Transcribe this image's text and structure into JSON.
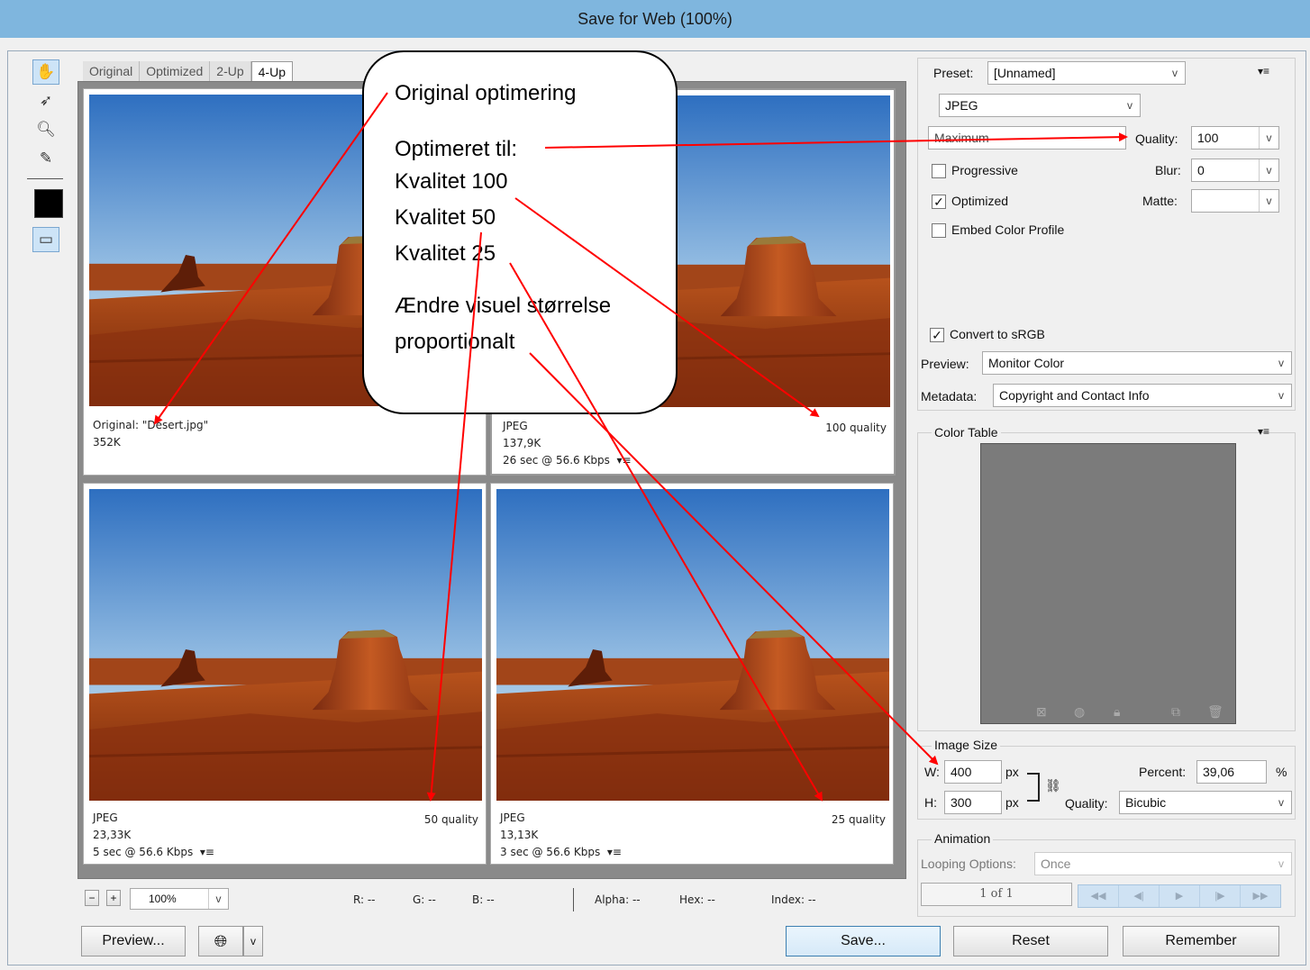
{
  "window": {
    "title": "Save for Web (100%)"
  },
  "tools": [
    {
      "icon": "hand-tool-icon"
    },
    {
      "icon": "slice-select-icon"
    },
    {
      "icon": "zoom-icon"
    },
    {
      "icon": "eyedropper-icon"
    },
    {
      "icon": "eyedropper-color-swatch-icon"
    },
    {
      "icon": "toggle-slices-icon"
    }
  ],
  "tabs": [
    "Original",
    "Optimized",
    "2-Up",
    "4-Up"
  ],
  "panes": [
    {
      "line1": "Original: \"Desert.jpg\"",
      "line2": "352K",
      "line3": "",
      "quality": ""
    },
    {
      "line1": "JPEG",
      "line2": "137,9K",
      "line3": "26 sec @ 56.6 Kbps",
      "quality": "100 quality"
    },
    {
      "line1": "JPEG",
      "line2": "23,33K",
      "line3": "5 sec @ 56.6 Kbps",
      "quality": "50 quality"
    },
    {
      "line1": "JPEG",
      "line2": "13,13K",
      "line3": "3 sec @ 56.6 Kbps",
      "quality": "25 quality"
    }
  ],
  "pane_menu_glyph": "▾≡",
  "zoom": {
    "minus": "−",
    "plus": "+",
    "value": "100%"
  },
  "status": {
    "r": "R: --",
    "g": "G: --",
    "b": "B: --",
    "alpha": "Alpha: --",
    "hex": "Hex: --",
    "index": "Index: --"
  },
  "bottom": {
    "preview": "Preview...",
    "save": "Save...",
    "reset": "Reset",
    "remember": "Remember"
  },
  "settings": {
    "preset_label": "Preset:",
    "preset_value": "[Unnamed]",
    "format": "JPEG",
    "quality_preset": "Maximum",
    "quality_label": "Quality:",
    "quality_value": "100",
    "blur_label": "Blur:",
    "blur_value": "0",
    "matte_label": "Matte:",
    "matte_value": "",
    "progressive": "Progressive",
    "progressive_checked": false,
    "optimized": "Optimized",
    "optimized_checked": true,
    "embed": "Embed Color Profile",
    "embed_checked": false,
    "convert": "Convert to sRGB",
    "convert_checked": true,
    "preview_label": "Preview:",
    "preview_value": "Monitor Color",
    "metadata_label": "Metadata:",
    "metadata_value": "Copyright and Contact Info"
  },
  "color_table": {
    "title": "Color Table",
    "swatch_color": "#7b7b7b"
  },
  "image_size": {
    "title": "Image Size",
    "w_label": "W:",
    "w_value": "400",
    "w_unit": "px",
    "h_label": "H:",
    "h_value": "300",
    "h_unit": "px",
    "percent_label": "Percent:",
    "percent_value": "39,06",
    "percent_unit": "%",
    "quality_label": "Quality:",
    "quality_value": "Bicubic"
  },
  "animation": {
    "title": "Animation",
    "looping_label": "Looping Options:",
    "looping_value": "Once",
    "frame": "1 of 1"
  },
  "checkmark": "✓",
  "dropdown_glyph": "v",
  "callout": {
    "line1": "Original optimering",
    "line2": "Optimeret til:",
    "line3": "Kvalitet 100",
    "line4": "Kvalitet 50",
    "line5": "Kvalitet 25",
    "line6": "Ændre visuel størrelse",
    "line7": "proportionalt"
  },
  "colors": {
    "arrow": "#ff0000",
    "title_bar": "#7fb6de",
    "panel": "#f0f0f0"
  }
}
